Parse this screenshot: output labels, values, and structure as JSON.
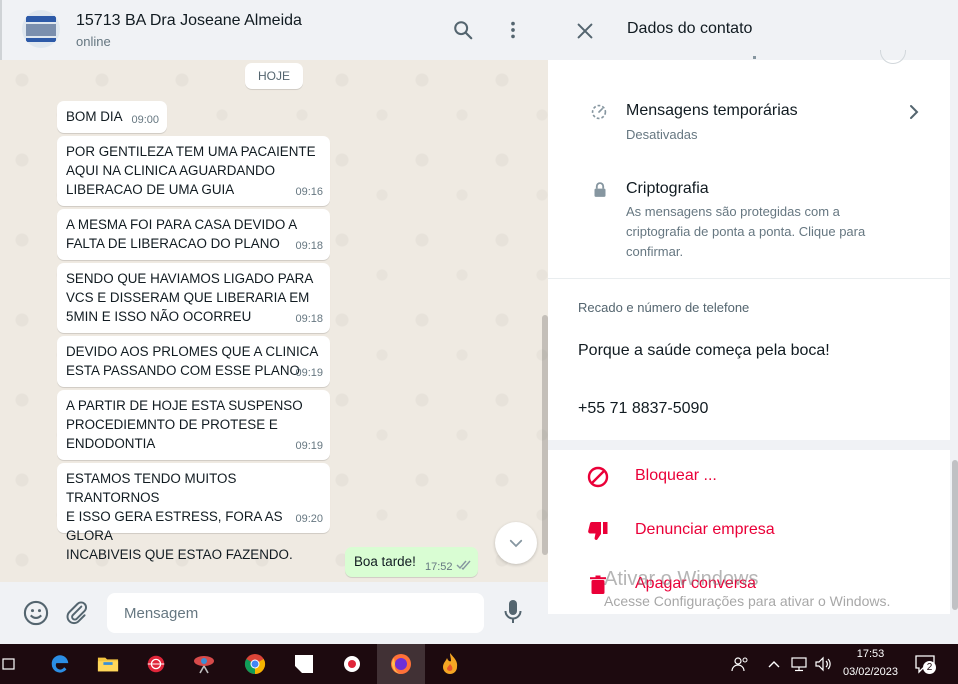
{
  "chat": {
    "contact_name": "15713 BA Dra Joseane Almeida",
    "status": "online",
    "date_chip": "HOJE",
    "incoming": [
      {
        "text": "BOM DIA",
        "time": "09:00"
      },
      {
        "text": "POR GENTILEZA TEM UMA PACAIENTE\nAQUI NA CLINICA AGUARDANDO\nLIBERACAO DE UMA GUIA",
        "time": "09:16"
      },
      {
        "text": "A MESMA FOI PARA CASA DEVIDO A\nFALTA DE LIBERACAO DO PLANO",
        "time": "09:18"
      },
      {
        "text": "SENDO QUE HAVIAMOS LIGADO PARA\nVCS E DISSERAM QUE LIBERARIA EM\n5MIN E ISSO NÃO OCORREU",
        "time": "09:18"
      },
      {
        "text": "DEVIDO AOS PRLOMES QUE A CLINICA\nESTA PASSANDO COM ESSE PLANO",
        "time": "09:19"
      },
      {
        "text": "A PARTIR DE HOJE ESTA SUSPENSO\nPROCEDIEMNTO DE PROTESE E\nENDODONTIA",
        "time": "09:19"
      },
      {
        "text": "ESTAMOS TENDO MUITOS TRANTORNOS\nE ISSO GERA ESTRESS, FORA AS GLORA\nINCABIVEIS QUE ESTAO FAZENDO.",
        "time": "09:20"
      }
    ],
    "outgoing": {
      "text": "Boa tarde!",
      "time": "17:52"
    },
    "composer_placeholder": "Mensagem"
  },
  "contact_info": {
    "title": "Dados do contato",
    "temporary_messages": {
      "title": "Mensagens temporárias",
      "subtitle": "Desativadas"
    },
    "encryption": {
      "title": "Criptografia",
      "subtitle": "As mensagens são protegidas com a criptografia de ponta a ponta. Clique para confirmar."
    },
    "about_label": "Recado e número de telefone",
    "about": "Porque a saúde começa pela boca!",
    "phone": "+55 71 8837-5090",
    "actions": {
      "block": "Bloquear ...",
      "report": "Denunciar empresa",
      "delete": "Apagar conversa"
    }
  },
  "watermark": {
    "title": "Ativar o Windows",
    "subtitle": "Acesse Configurações para ativar o Windows."
  },
  "taskbar": {
    "time": "17:53",
    "date": "03/02/2023",
    "notification_count": "2"
  },
  "colors": {
    "danger": "#ea0038",
    "outgoing_bubble": "#d9fdd3",
    "chat_background": "#efeae2",
    "taskbar": "#1d0a0f"
  }
}
